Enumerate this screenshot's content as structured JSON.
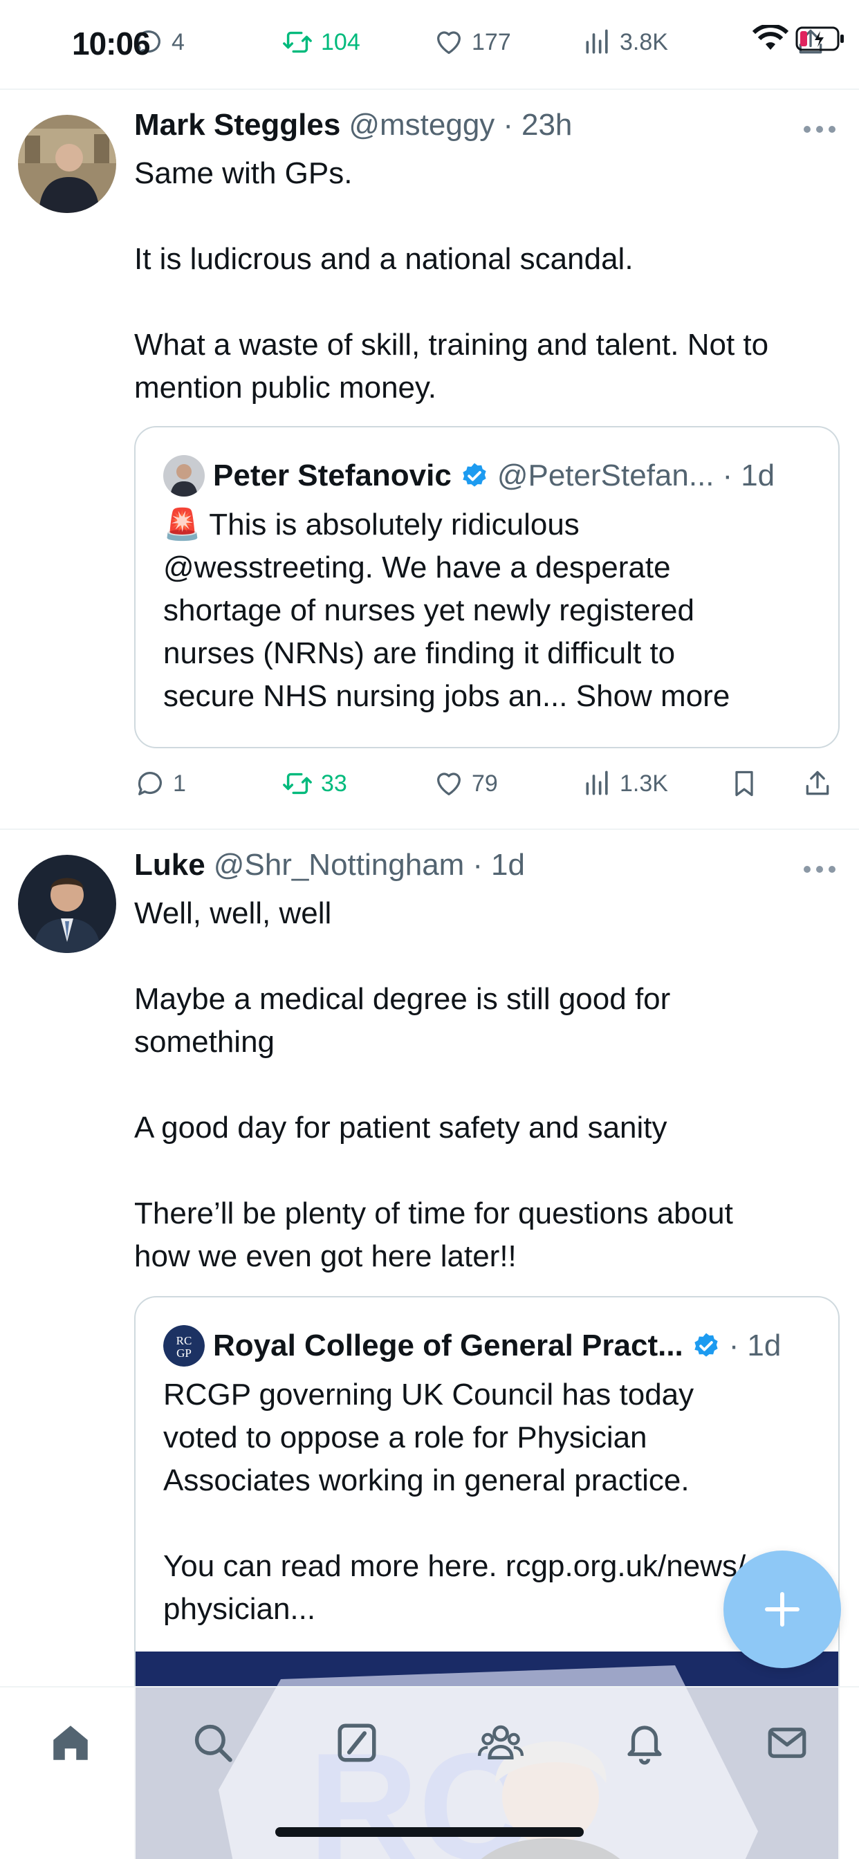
{
  "status_bar": {
    "time": "10:06"
  },
  "colors": {
    "accent": "#1d9bf0",
    "repost_green": "#00ba7c",
    "secondary_text": "#536471",
    "fab": "#8ec8f6",
    "rcgp_navy": "#1c3263"
  },
  "prev_post_actions": {
    "replies": "4",
    "reposts": "104",
    "likes": "177",
    "views": "3.8K"
  },
  "posts": [
    {
      "name": "Mark Steggles",
      "handle": "@msteggy",
      "time": "23h",
      "text": [
        "Same with GPs.",
        "",
        "It is ludicrous and a national scandal.",
        "",
        "What a waste of skill, training and talent. Not to",
        "mention public money."
      ],
      "quote": {
        "name": "Peter Stefanovic",
        "verified": true,
        "handle": "@PeterStefan...",
        "time": "1d",
        "emoji": "🚨",
        "text": [
          "This is absolutely ridiculous",
          "@wesstreeting. We have a desperate",
          "shortage of nurses yet newly registered",
          "nurses (NRNs) are finding it difficult to",
          "secure NHS nursing jobs an..."
        ],
        "show_more": "Show more"
      },
      "actions": {
        "replies": "1",
        "reposts": "33",
        "likes": "79",
        "views": "1.3K"
      }
    },
    {
      "name": "Luke",
      "handle": "@Shr_Nottingham",
      "time": "1d",
      "text": [
        "Well, well, well",
        "",
        "Maybe a medical degree is still good for",
        "something",
        "",
        "A good day for patient safety and sanity",
        "",
        "There’ll be plenty of time for questions about",
        "how we even got here later!!"
      ],
      "quote": {
        "name": "Royal College of General Pract...",
        "verified": true,
        "time": "1d",
        "avatar_text": "RC GP",
        "text": [
          "RCGP governing UK Council has today",
          "voted to oppose a role for Physician",
          "Associates working in general practice.",
          "",
          "You can read more here. rcgp.org.uk/news/",
          "physician..."
        ],
        "image_watermark": "RC"
      }
    }
  ],
  "tabs": [
    "home-icon",
    "search-icon",
    "grok-icon",
    "communities-icon",
    "notifications-icon",
    "messages-icon"
  ],
  "fab": {
    "icon": "plus-icon"
  }
}
